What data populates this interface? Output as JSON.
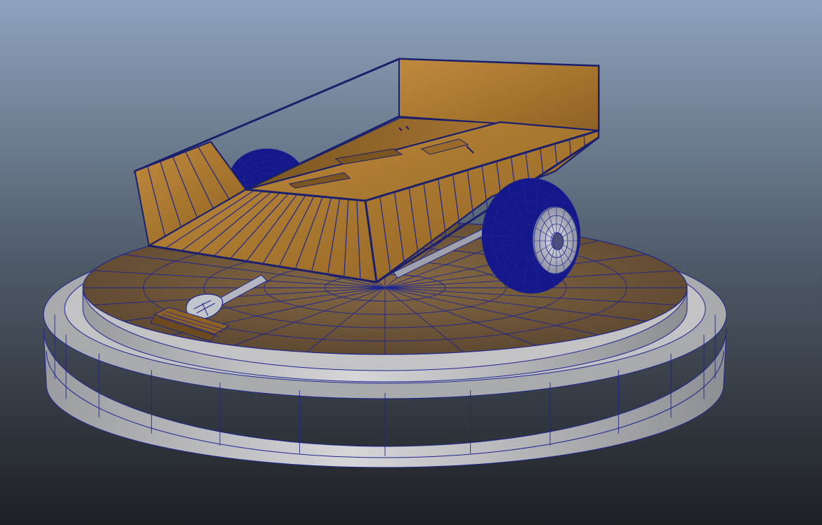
{
  "viewport": {
    "kind": "3d-modeling-viewport",
    "display_mode": "wireframe-on-shaded",
    "background_top": "#8ea3bd",
    "background_bottom": "#1e2024"
  },
  "scene": {
    "model": "two-wheel-cart",
    "pedestal": {
      "top_color": "#6f5839",
      "side_color": "#c9c9cb",
      "radial_segments": 24,
      "ring_count": 5
    },
    "cart": {
      "wood_color": "#b07f37",
      "wood_dark": "#8a5f24",
      "frame_color": "#1a1f6b"
    },
    "wheels": {
      "tire_color": "#15188a",
      "rim_color": "#b5b7c2",
      "count": 2
    },
    "wire_color": "#1c2590",
    "tow_bar_color": "#b3b6c0"
  }
}
